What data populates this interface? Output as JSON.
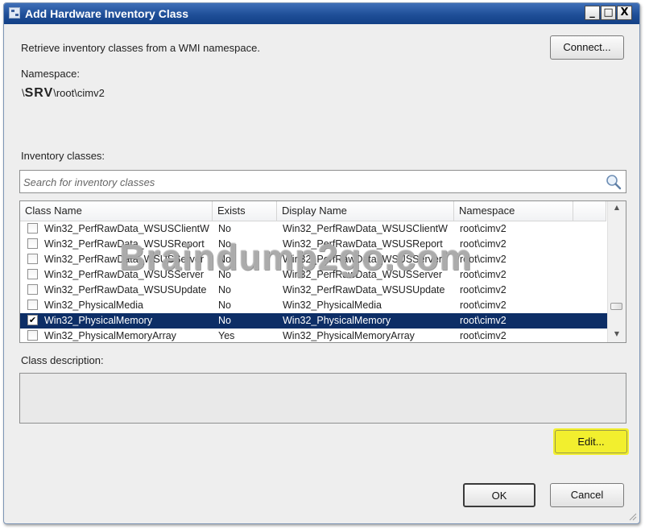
{
  "window": {
    "title": "Add Hardware Inventory Class",
    "minimize_label": "_",
    "maximize_label": "□",
    "close_label": "X"
  },
  "intro_text": "Retrieve inventory classes from a WMI namespace.",
  "connect_label": "Connect...",
  "namespace": {
    "label": "Namespace:",
    "prefix": "\\",
    "server": "SRV",
    "path": "\\root\\cimv2"
  },
  "inventory_classes": {
    "label": "Inventory classes:",
    "search_placeholder": "Search for inventory classes",
    "columns": [
      "Class Name",
      "Exists",
      "Display Name",
      "Namespace"
    ],
    "rows": [
      {
        "checked": false,
        "class_name": "Win32_PerfRawData_WSUSClientW",
        "exists": "No",
        "display_name": "Win32_PerfRawData_WSUSClientW",
        "namespace": "root\\cimv2"
      },
      {
        "checked": false,
        "class_name": "Win32_PerfRawData_WSUSReport",
        "exists": "No",
        "display_name": "Win32_PerfRawData_WSUSReport",
        "namespace": "root\\cimv2"
      },
      {
        "checked": false,
        "class_name": "Win32_PerfRawData_WSUSServer",
        "exists": "No",
        "display_name": "Win32_PerfRawData_WSUSServer",
        "namespace": "root\\cimv2"
      },
      {
        "checked": false,
        "class_name": "Win32_PerfRawData_WSUSServer",
        "exists": "No",
        "display_name": "Win32_PerfRawData_WSUSServer",
        "namespace": "root\\cimv2"
      },
      {
        "checked": false,
        "class_name": "Win32_PerfRawData_WSUSUpdate",
        "exists": "No",
        "display_name": "Win32_PerfRawData_WSUSUpdate",
        "namespace": "root\\cimv2"
      },
      {
        "checked": false,
        "class_name": "Win32_PhysicalMedia",
        "exists": "No",
        "display_name": "Win32_PhysicalMedia",
        "namespace": "root\\cimv2"
      },
      {
        "checked": true,
        "selected": true,
        "class_name": "Win32_PhysicalMemory",
        "exists": "No",
        "display_name": "Win32_PhysicalMemory",
        "namespace": "root\\cimv2"
      },
      {
        "checked": false,
        "class_name": "Win32_PhysicalMemoryArray",
        "exists": "Yes",
        "display_name": "Win32_PhysicalMemoryArray",
        "namespace": "root\\cimv2"
      }
    ]
  },
  "class_description": {
    "label": "Class description:",
    "value": ""
  },
  "buttons": {
    "edit": "Edit...",
    "ok": "OK",
    "cancel": "Cancel"
  },
  "watermark": "Braindump2go.com",
  "colors": {
    "titlebar": "#1f4f98",
    "selected_row": "#0d2e66",
    "highlight": "#f2ef2e",
    "dialog_bg": "#eeeeee"
  },
  "icons": {
    "search": "magnifier-icon",
    "checkbox_checked": "✔"
  }
}
